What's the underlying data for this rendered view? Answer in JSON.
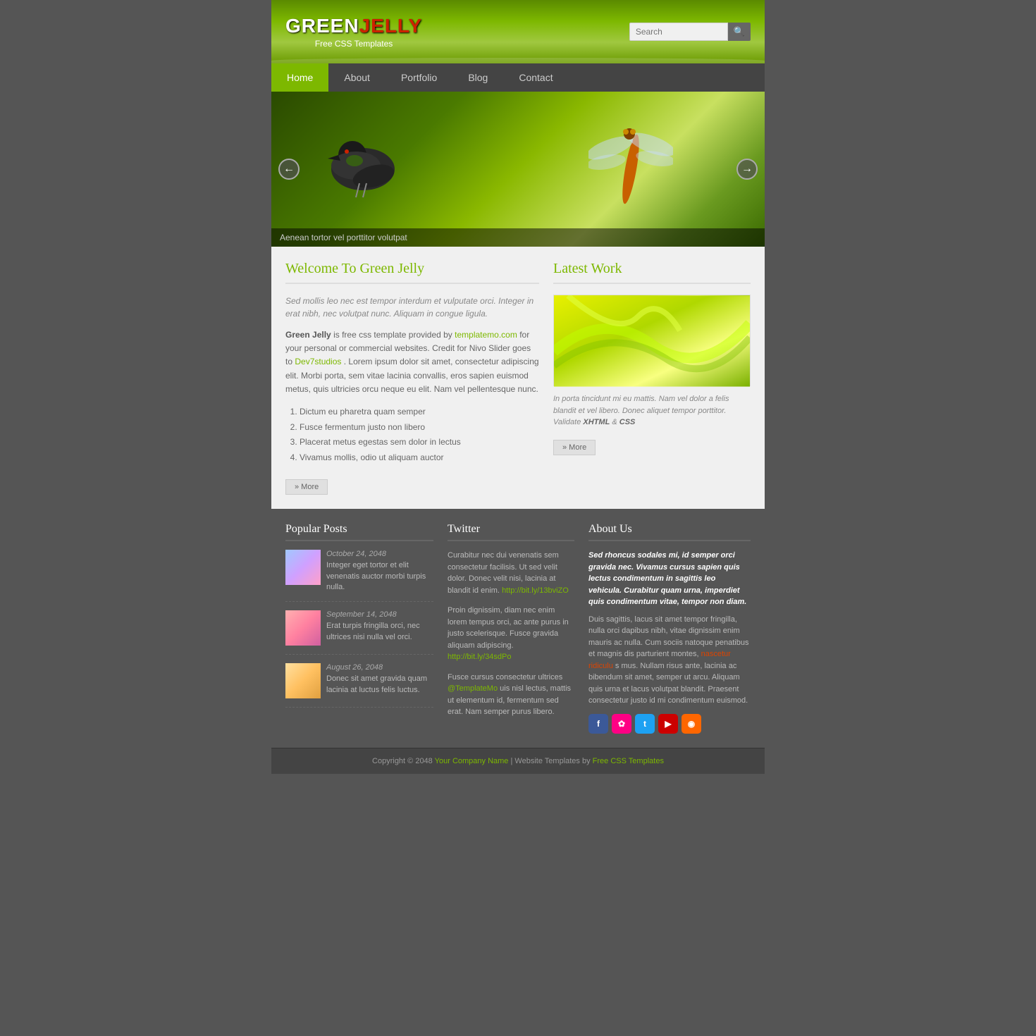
{
  "header": {
    "logo_green": "GREEN",
    "logo_jelly": "JELLY",
    "logo_subtitle": "Free CSS Templates",
    "search_placeholder": "Search"
  },
  "nav": {
    "items": [
      {
        "label": "Home",
        "active": true
      },
      {
        "label": "About",
        "active": false
      },
      {
        "label": "Portfolio",
        "active": false
      },
      {
        "label": "Blog",
        "active": false
      },
      {
        "label": "Contact",
        "active": false
      }
    ]
  },
  "slider": {
    "caption": "Aenean tortor vel porttitor volutpat"
  },
  "welcome": {
    "title": "Welcome To Green Jelly",
    "intro": "Sed mollis leo nec est tempor interdum et vulputate orci. Integer in erat nibh, nec volutpat nunc. Aliquam in congue ligula.",
    "body1": "is free css template provided by",
    "link1": "templatemo.com",
    "body2": "for your personal or commercial websites. Credit for Nivo Slider goes to",
    "link2": "Dev7studios",
    "body3": ". Lorem ipsum dolor sit amet, consectetur adipiscing elit. Morbi porta, sem vitae lacinia convallis, eros sapien euismod metus, quis ultricies orcu neque eu elit. Nam vel pellentesque nunc.",
    "brand": "Green Jelly",
    "list": [
      "Dictum eu pharetra quam semper",
      "Fusce fermentum justo non libero",
      "Placerat metus egestas sem dolor in lectus",
      "Vivamus mollis, odio ut aliquam auctor"
    ],
    "more_btn": "» More"
  },
  "latest_work": {
    "title": "Latest Work",
    "caption": "In porta tincidunt mi eu mattis. Nam vel dolor a felis blandit et vel libero. Donec aliquet tempor porttitor. Validate",
    "xhtml_label": "XHTML",
    "css_label": "CSS",
    "more_btn": "» More"
  },
  "popular_posts": {
    "title": "Popular Posts",
    "posts": [
      {
        "date": "October 24, 2048",
        "text": "Integer eget tortor et elit venenatis auctor morbi turpis nulla.",
        "thumb": "thumb1"
      },
      {
        "date": "September 14, 2048",
        "text": "Erat turpis fringilla orci, nec ultrices nisi nulla vel orci.",
        "thumb": "thumb2"
      },
      {
        "date": "August 26, 2048",
        "text": "Donec sit amet gravida quam lacinia at luctus felis luctus.",
        "thumb": "thumb3"
      }
    ]
  },
  "twitter": {
    "title": "Twitter",
    "tweets": [
      {
        "text": "Curabitur nec dui venenatis sem consectetur facilisis. Ut sed velit dolor. Donec velit nisi, lacinia at blandit id enim.",
        "link": "http://bit.ly/13bviZO"
      },
      {
        "text": "Proin dignissim, diam nec enim lorem tempus orci, ac ante purus in justo scelerisque. Fusce gravida aliquam adipiscing.",
        "link": "http://bit.ly/34sdPo"
      },
      {
        "text": "Fusce cursus consectetur ultrices",
        "handle": "@TemplateMo",
        "text2": "uis nisl lectus, mattis ut elementum id, fermentum sed erat. Nam semper purus libero."
      }
    ]
  },
  "about_us": {
    "title": "About Us",
    "para1": "Sed rhoncus sodales mi, id semper orci gravida nec. Vivamus cursus sapien quis lectus condimentum in sagittis leo vehicula. Curabitur quam urna, imperdiet quis condimentum vitae, tempor non diam.",
    "para2": "Duis sagittis, lacus sit amet tempor fringilla, nulla orci dapibus nibh, vitae dignissim enim mauris ac nulla. Cum sociis natoque penatibus et magnis dis parturient montes,",
    "highlight": "nascetur ridiculu",
    "para3": "s mus. Nullam risus ante, lacinia ac bibendum sit amet, semper ut arcu. Aliquam quis urna et lacus volutpat blandit. Praesent consectetur justo id mi condimentum euismod.",
    "social": {
      "facebook": "f",
      "flickr": "✿",
      "twitter": "t",
      "youtube": "▶",
      "rss": "◉"
    }
  },
  "footer": {
    "text": "Copyright © 2048",
    "company": "Your Company Name",
    "sep": " | Website Templates by ",
    "link": "Free CSS Templates"
  }
}
